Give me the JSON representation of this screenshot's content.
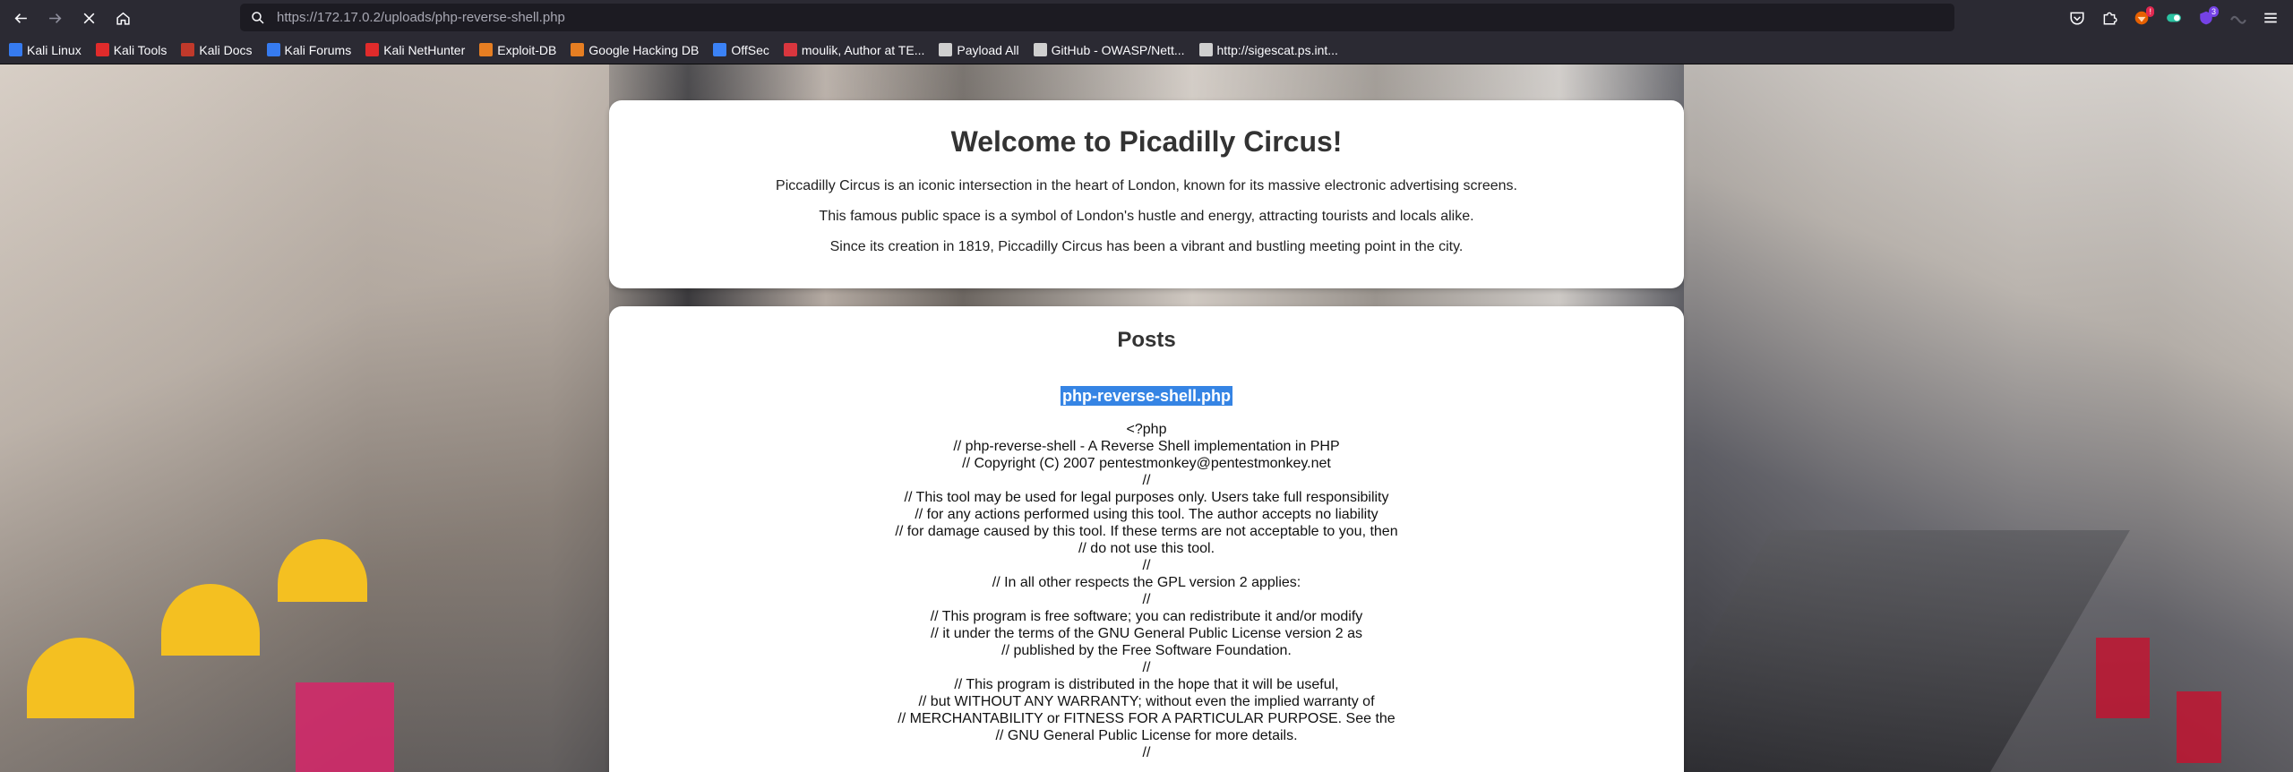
{
  "browser": {
    "url_host": "https://172.17.0.2",
    "url_path": "/uploads/php-reverse-shell.php",
    "bookmarks": [
      {
        "label": "Kali Linux",
        "color": "#367bf0"
      },
      {
        "label": "Kali Tools",
        "color": "#e02b2b"
      },
      {
        "label": "Kali Docs",
        "color": "#c0392b"
      },
      {
        "label": "Kali Forums",
        "color": "#367bf0"
      },
      {
        "label": "Kali NetHunter",
        "color": "#e02b2b"
      },
      {
        "label": "Exploit-DB",
        "color": "#e67e22"
      },
      {
        "label": "Google Hacking DB",
        "color": "#e67e22"
      },
      {
        "label": "OffSec",
        "color": "#3b82f6"
      },
      {
        "label": "moulik, Author at TE...",
        "color": "#d9363e"
      },
      {
        "label": "Payload All",
        "color": "#cfcfcf"
      },
      {
        "label": "GitHub - OWASP/Nett...",
        "color": "#cfcfcf"
      },
      {
        "label": "http://sigescat.ps.int...",
        "color": "#cfcfcf"
      }
    ]
  },
  "welcome": {
    "title": "Welcome to Picadilly Circus!",
    "p1": "Piccadilly Circus is an iconic intersection in the heart of London, known for its massive electronic advertising screens.",
    "p2": "This famous public space is a symbol of London's hustle and energy, attracting tourists and locals alike.",
    "p3": "Since its creation in 1819, Piccadilly Circus has been a vibrant and bustling meeting point in the city."
  },
  "posts": {
    "heading": "Posts",
    "post_title": "php-reverse-shell.php",
    "lines": [
      "<?php",
      "// php-reverse-shell - A Reverse Shell implementation in PHP",
      "// Copyright (C) 2007 pentestmonkey@pentestmonkey.net",
      "//",
      "// This tool may be used for legal purposes only. Users take full responsibility",
      "// for any actions performed using this tool. The author accepts no liability",
      "// for damage caused by this tool. If these terms are not acceptable to you, then",
      "// do not use this tool.",
      "//",
      "// In all other respects the GPL version 2 applies:",
      "//",
      "// This program is free software; you can redistribute it and/or modify",
      "// it under the terms of the GNU General Public License version 2 as",
      "// published by the Free Software Foundation.",
      "//",
      "// This program is distributed in the hope that it will be useful,",
      "// but WITHOUT ANY WARRANTY; without even the implied warranty of",
      "// MERCHANTABILITY or FITNESS FOR A PARTICULAR PURPOSE. See the",
      "// GNU General Public License for more details.",
      "//"
    ]
  }
}
